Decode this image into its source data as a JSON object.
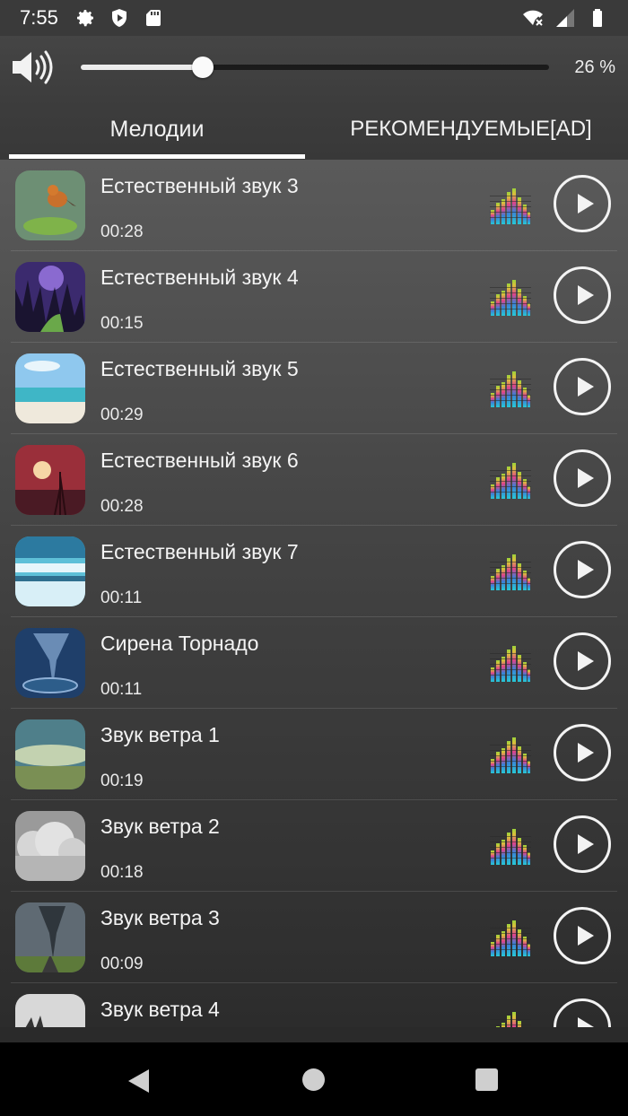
{
  "status_bar": {
    "time": "7:55",
    "icons_left": [
      "gear-icon",
      "shield-play-icon",
      "sd-card-icon"
    ],
    "icons_right": [
      "wifi-off-icon",
      "cell-signal-icon",
      "battery-icon"
    ]
  },
  "volume": {
    "icon": "speaker-icon",
    "level": 0.26,
    "percent_label": "26 %"
  },
  "tabs": [
    {
      "label": "Мелодии",
      "active": true
    },
    {
      "label": "РЕКОМЕНДУЕМЫЕ[AD]",
      "active": false
    }
  ],
  "sounds": [
    {
      "title": "Естественный звук 3",
      "duration": "00:28",
      "thumb": "robin-bird"
    },
    {
      "title": "Естественный звук 4",
      "duration": "00:15",
      "thumb": "purple-forest-path"
    },
    {
      "title": "Естественный звук 5",
      "duration": "00:29",
      "thumb": "tropical-beach"
    },
    {
      "title": "Естественный звук 6",
      "duration": "00:28",
      "thumb": "sunset-bird"
    },
    {
      "title": "Естественный звук 7",
      "duration": "00:11",
      "thumb": "waterfall"
    },
    {
      "title": "Сирена Торнадо",
      "duration": "00:11",
      "thumb": "tornado-water"
    },
    {
      "title": "Звук ветра 1",
      "duration": "00:19",
      "thumb": "storm-shelf-cloud"
    },
    {
      "title": "Звук ветра 2",
      "duration": "00:18",
      "thumb": "grey-clouds"
    },
    {
      "title": "Звук ветра 3",
      "duration": "00:09",
      "thumb": "tornado-road"
    },
    {
      "title": "Звук ветра 4",
      "duration": "",
      "thumb": "windy-grass"
    }
  ],
  "nav_bar": {
    "back": "back-icon",
    "home": "home-icon",
    "recent": "recent-apps-icon"
  }
}
